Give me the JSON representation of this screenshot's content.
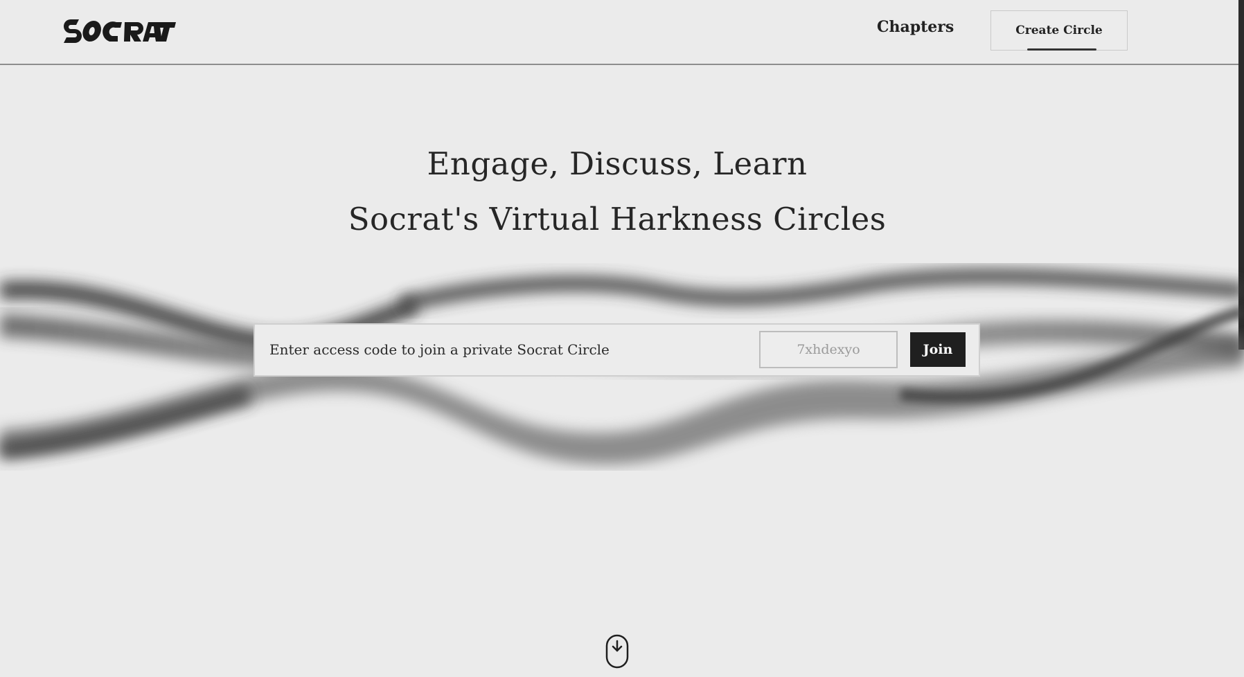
{
  "header": {
    "logo_icon": "socrat-logo-icon",
    "nav": {
      "chapters_label": "Chapters",
      "create_circle_label": "Create Circle"
    }
  },
  "hero": {
    "title_line1": "Engage, Discuss, Learn",
    "title_line2": "Socrat's Virtual Harkness Circles"
  },
  "access_form": {
    "label": "Enter access code to join a private Socrat Circle",
    "code_placeholder": "7xhdexyo",
    "code_value": "",
    "join_label": "Join"
  },
  "scroll_indicator": {
    "icon": "mouse-scroll-down-icon"
  },
  "colors": {
    "background": "#ebebeb",
    "text": "#222222",
    "button_dark": "#1f1f1f",
    "border": "#8d8d8d"
  }
}
